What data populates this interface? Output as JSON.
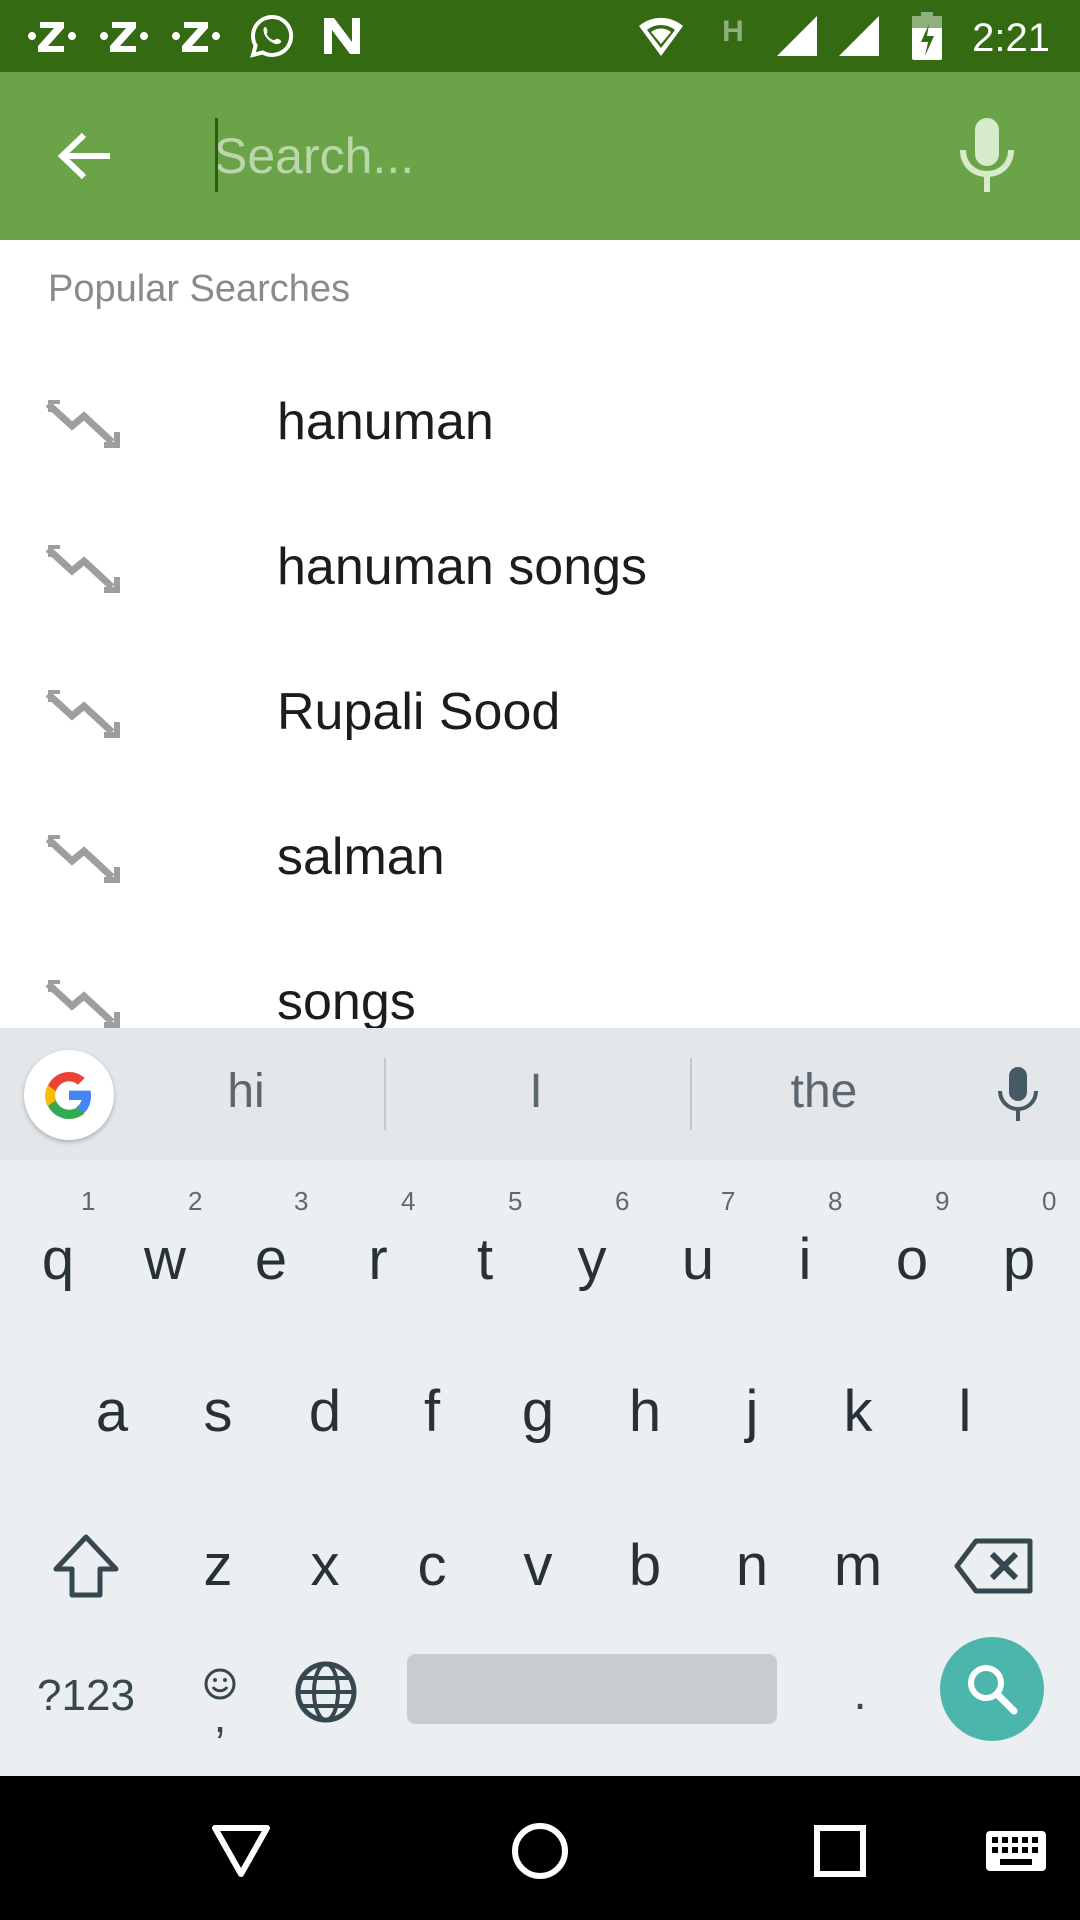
{
  "status_bar": {
    "time": "2:21",
    "network_label": "H",
    "left_icons": [
      "z-notification-icon",
      "z-notification-icon",
      "z-notification-icon",
      "whatsapp-icon",
      "n-notification-icon"
    ],
    "right_icons": [
      "wifi-icon",
      "signal-icon",
      "signal-icon",
      "battery-charging-icon"
    ]
  },
  "app_bar": {
    "search_placeholder": "Search...",
    "search_value": "",
    "icons": {
      "back": "arrow-back-icon",
      "mic": "mic-icon"
    }
  },
  "popular": {
    "label": "Popular Searches",
    "items": [
      {
        "text": "hanuman",
        "icon": "trending-icon"
      },
      {
        "text": "hanuman songs",
        "icon": "trending-icon"
      },
      {
        "text": "Rupali Sood",
        "icon": "trending-icon"
      },
      {
        "text": "salman",
        "icon": "trending-icon"
      },
      {
        "text": "songs",
        "icon": "trending-icon"
      }
    ]
  },
  "keyboard": {
    "suggestions": [
      "hi",
      "I",
      "the"
    ],
    "row1": [
      "q",
      "w",
      "e",
      "r",
      "t",
      "y",
      "u",
      "i",
      "o",
      "p"
    ],
    "row1_hints": [
      "1",
      "2",
      "3",
      "4",
      "5",
      "6",
      "7",
      "8",
      "9",
      "0"
    ],
    "row2": [
      "a",
      "s",
      "d",
      "f",
      "g",
      "h",
      "j",
      "k",
      "l"
    ],
    "row3": [
      "z",
      "x",
      "c",
      "v",
      "b",
      "n",
      "m"
    ],
    "symbols_label": "?123",
    "comma_label": ",",
    "period_label": ".",
    "colors": {
      "search_key": "#4db6ac",
      "background": "#eceff1"
    }
  },
  "colors": {
    "status_bar": "#336a12",
    "app_bar": "#6ba448"
  }
}
